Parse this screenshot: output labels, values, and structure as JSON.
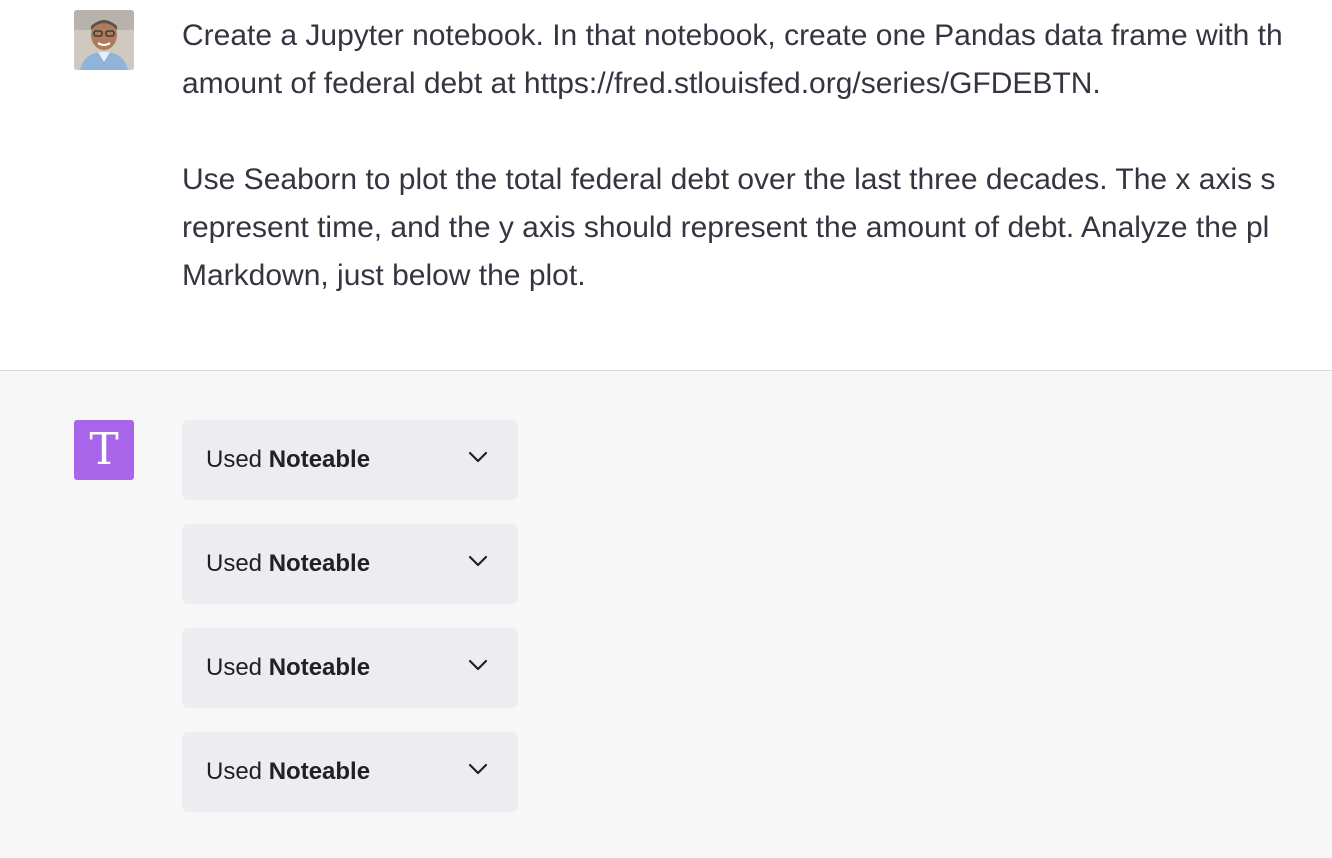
{
  "user_message": {
    "paragraphs": [
      [
        "Create a Jupyter notebook. In that notebook, create one Pandas data frame with th",
        "amount of federal debt at https://fred.stlouisfed.org/series/GFDEBTN."
      ],
      [
        "Use Seaborn to plot the total federal debt over the last three decades. The x axis s",
        "represent time, and the y axis should represent the amount of debt. Analyze the pl",
        "Markdown, just below the plot."
      ]
    ]
  },
  "assistant": {
    "avatar_letter": "T",
    "avatar_color": "#a865ea",
    "tool_calls": [
      {
        "prefix": "Used",
        "plugin": "Noteable"
      },
      {
        "prefix": "Used",
        "plugin": "Noteable"
      },
      {
        "prefix": "Used",
        "plugin": "Noteable"
      },
      {
        "prefix": "Used",
        "plugin": "Noteable"
      }
    ],
    "icons": {
      "expand": "chevron-down-icon"
    }
  },
  "colors": {
    "user_bg": "#ffffff",
    "assistant_bg": "#f7f7f8",
    "tool_bg": "#ececf1",
    "text": "#343541"
  }
}
